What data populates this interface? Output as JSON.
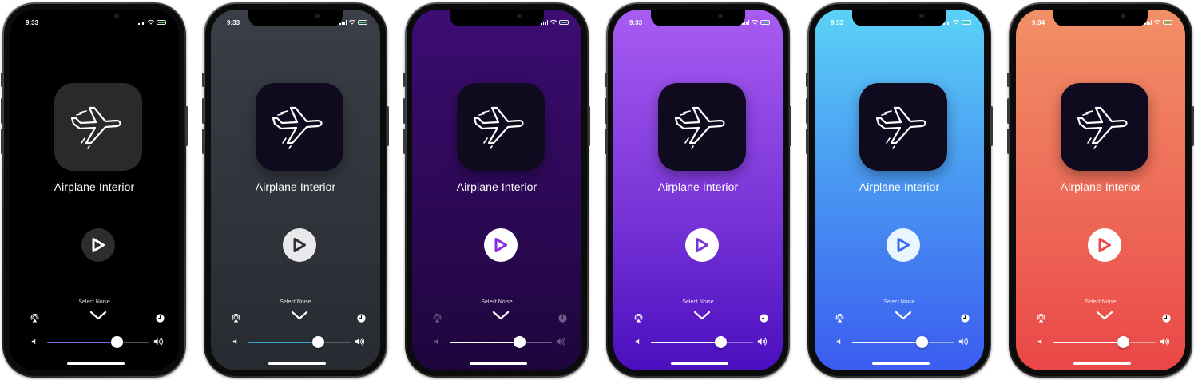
{
  "phones": [
    {
      "time": "9:33",
      "title": "Airplane Interior",
      "select_label": "Select Noise",
      "volume_level": 0.68,
      "bg": "linear-gradient(180deg,#000000 0%,#000000 100%)",
      "icon_bg": "#2a2a2a",
      "play_bg": "#2d2d2d",
      "play_fg": "#ffffff",
      "track_color": "#4e4e4e",
      "fill_color": "#7a6cd6",
      "accent_icons": "#ffffff",
      "icon_names": [
        "airplane-icon",
        "play-icon",
        "airplay-icon",
        "timer-icon",
        "chevron-down-icon",
        "volume-low-icon",
        "volume-high-icon"
      ]
    },
    {
      "time": "9:33",
      "title": "Airplane Interior",
      "select_label": "Select Noise",
      "volume_level": 0.68,
      "bg": "linear-gradient(180deg,#3a3f47 0%,#272b31 100%)",
      "icon_bg": "#0f0a1e",
      "play_bg": "#e9e9ec",
      "play_fg": "#2b2f36",
      "track_color": "#5a5f67",
      "fill_color": "#3aa6d9",
      "accent_icons": "#ffffff",
      "icon_names": [
        "airplane-icon",
        "play-icon",
        "airplay-icon",
        "timer-icon",
        "chevron-down-icon",
        "volume-low-icon",
        "volume-high-icon"
      ]
    },
    {
      "time": "",
      "title": "Airplane Interior",
      "select_label": "Select Noise",
      "volume_level": 0.68,
      "bg": "linear-gradient(180deg,#3d0d74 0%,#2a0852 60%,#1e063d 100%)",
      "icon_bg": "#0f0a1e",
      "play_bg": "#ffffff",
      "play_fg": "#8a2be2",
      "track_color": "#6a5a8a",
      "fill_color": "#ffffff",
      "accent_icons": "rgba(255,255,255,0.35)",
      "icon_names": [
        "airplane-icon",
        "play-icon",
        "airplay-icon",
        "timer-icon",
        "chevron-down-icon",
        "volume-low-icon",
        "volume-high-icon"
      ]
    },
    {
      "time": "9:33",
      "title": "Airplane Interior",
      "select_label": "Select Noise",
      "volume_level": 0.68,
      "bg": "linear-gradient(180deg,#a85cf2 0%,#7a35d8 55%,#4a0fbf 100%)",
      "icon_bg": "#0f0a1e",
      "play_bg": "#ffffff",
      "play_fg": "#7a35d8",
      "track_color": "#9b6ce0",
      "fill_color": "#ffffff",
      "accent_icons": "#ffffff",
      "icon_names": [
        "airplane-icon",
        "play-icon",
        "airplay-icon",
        "timer-icon",
        "chevron-down-icon",
        "volume-low-icon",
        "volume-high-icon"
      ]
    },
    {
      "time": "9:33",
      "title": "Airplane Interior",
      "select_label": "Select Noise",
      "volume_level": 0.68,
      "bg": "linear-gradient(180deg,#5ad2f7 0%,#4a9af2 45%,#3b5cf0 100%)",
      "icon_bg": "#0f0a1e",
      "play_bg": "#eaf6ff",
      "play_fg": "#3b6af0",
      "track_color": "#8fb2f7",
      "fill_color": "#ffffff",
      "accent_icons": "#ffffff",
      "icon_names": [
        "airplane-icon",
        "play-icon",
        "airplay-icon",
        "timer-icon",
        "chevron-down-icon",
        "volume-low-icon",
        "volume-high-icon"
      ]
    },
    {
      "time": "9:34",
      "title": "Airplane Interior",
      "select_label": "Select Noise",
      "volume_level": 0.68,
      "bg": "linear-gradient(180deg,#f29067 0%,#ee6d58 50%,#ea4747 100%)",
      "icon_bg": "#0f0a1e",
      "play_bg": "#ffffff",
      "play_fg": "#ea4a4a",
      "track_color": "#f5a69a",
      "fill_color": "#ffffff",
      "accent_icons": "#ffffff",
      "icon_names": [
        "airplane-icon",
        "play-icon",
        "airplay-icon",
        "timer-icon",
        "chevron-down-icon",
        "volume-low-icon",
        "volume-high-icon"
      ]
    }
  ]
}
